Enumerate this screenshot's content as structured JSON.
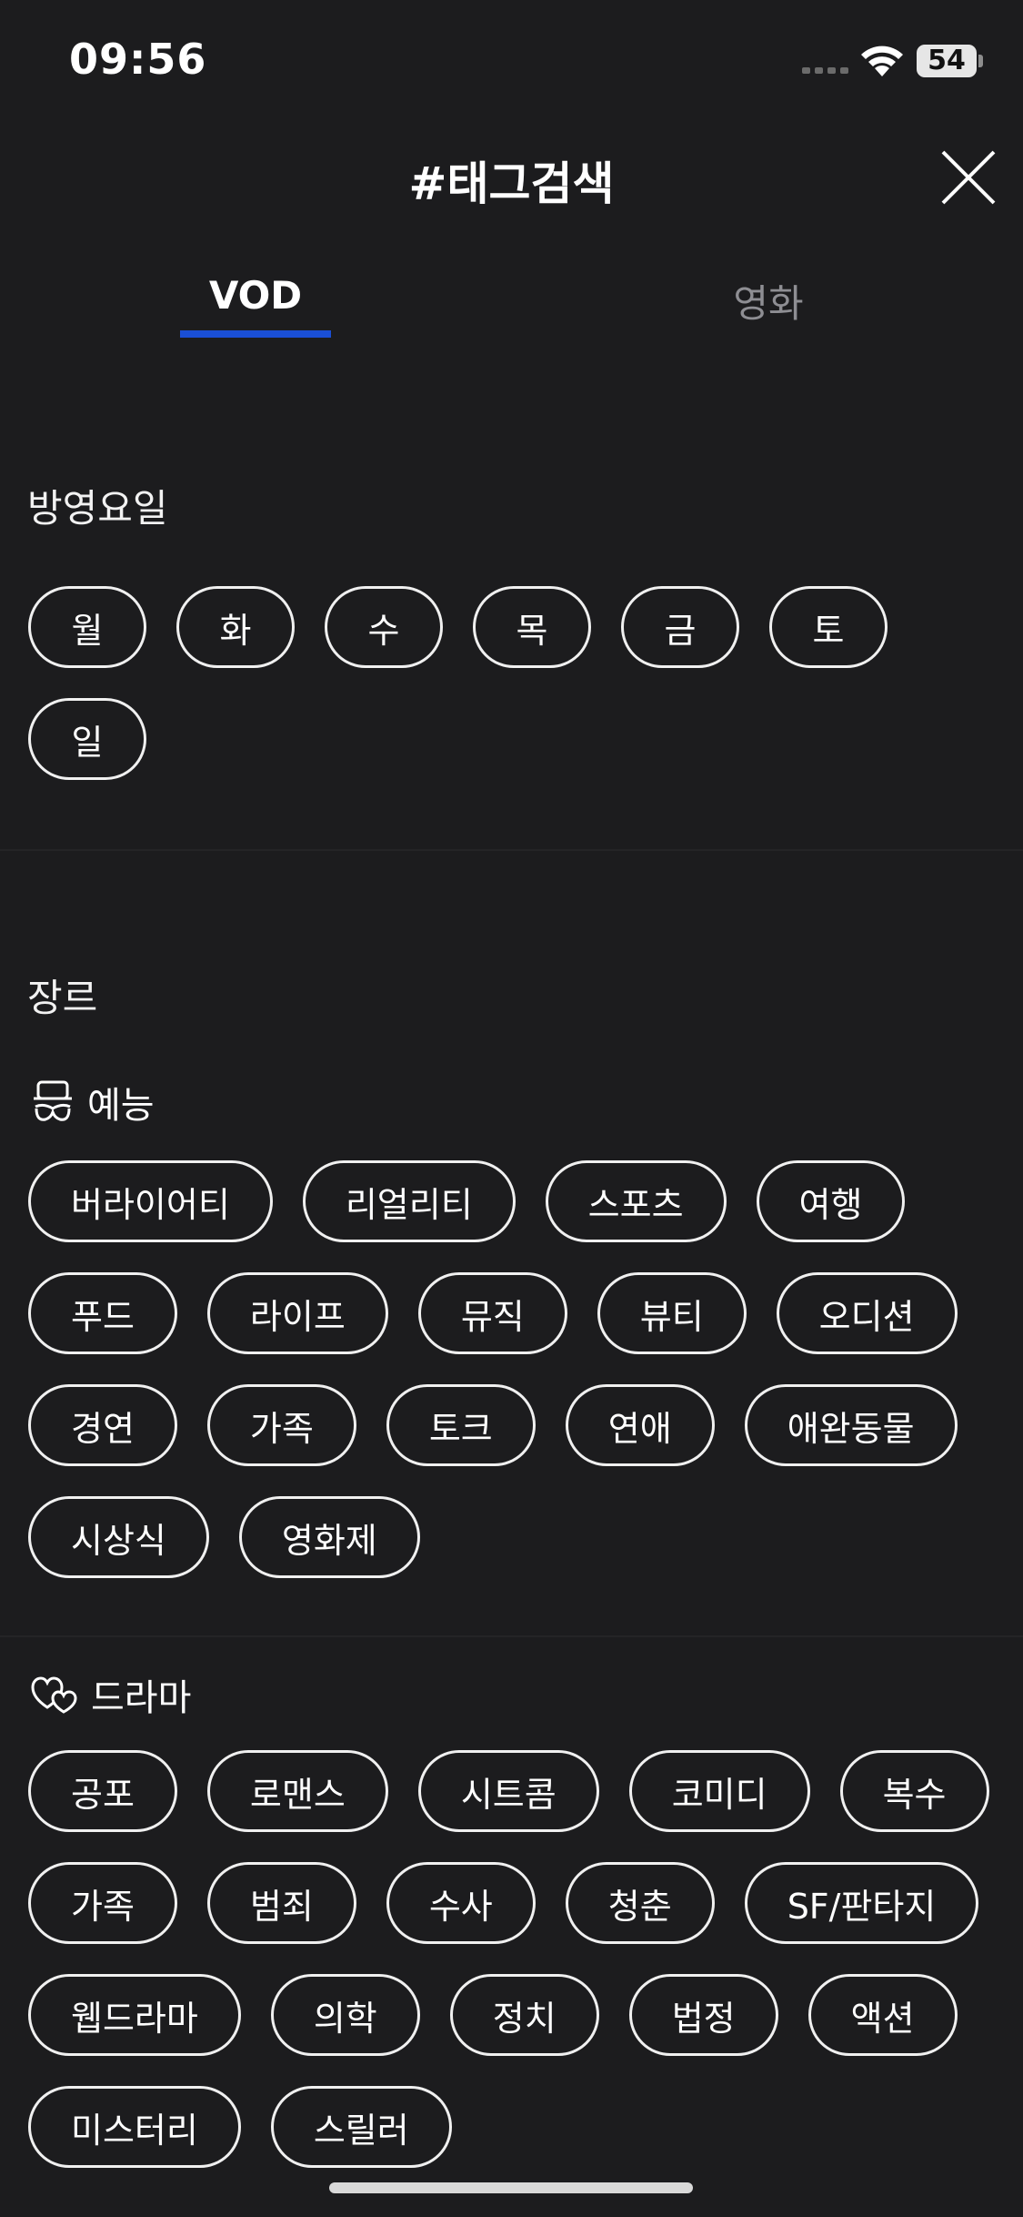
{
  "status": {
    "time": "09:56",
    "battery": "54"
  },
  "header": {
    "title": "#태그검색"
  },
  "tabs": [
    {
      "label": "VOD",
      "active": true
    },
    {
      "label": "영화",
      "active": false
    }
  ],
  "days": {
    "label": "방영요일",
    "items": [
      "월",
      "화",
      "수",
      "목",
      "금",
      "토",
      "일"
    ]
  },
  "genre": {
    "label": "장르",
    "variety": {
      "label": "예능",
      "icon": "mustache-face-icon",
      "items": [
        "버라이어티",
        "리얼리티",
        "스포츠",
        "여행",
        "푸드",
        "라이프",
        "뮤직",
        "뷰티",
        "오디션",
        "경연",
        "가족",
        "토크",
        "연애",
        "애완동물",
        "시상식",
        "영화제"
      ]
    },
    "drama": {
      "label": "드라마",
      "icon": "hearts-icon",
      "items": [
        "공포",
        "로맨스",
        "시트콤",
        "코미디",
        "복수",
        "가족",
        "범죄",
        "수사",
        "청춘",
        "SF/판타지",
        "웹드라마",
        "의학",
        "정치",
        "법정",
        "액션",
        "미스터리",
        "스릴러"
      ]
    }
  },
  "colors": {
    "background": "#1c1c1e",
    "accent": "#1a4fd6",
    "inactive_tab": "#8e8e93"
  }
}
